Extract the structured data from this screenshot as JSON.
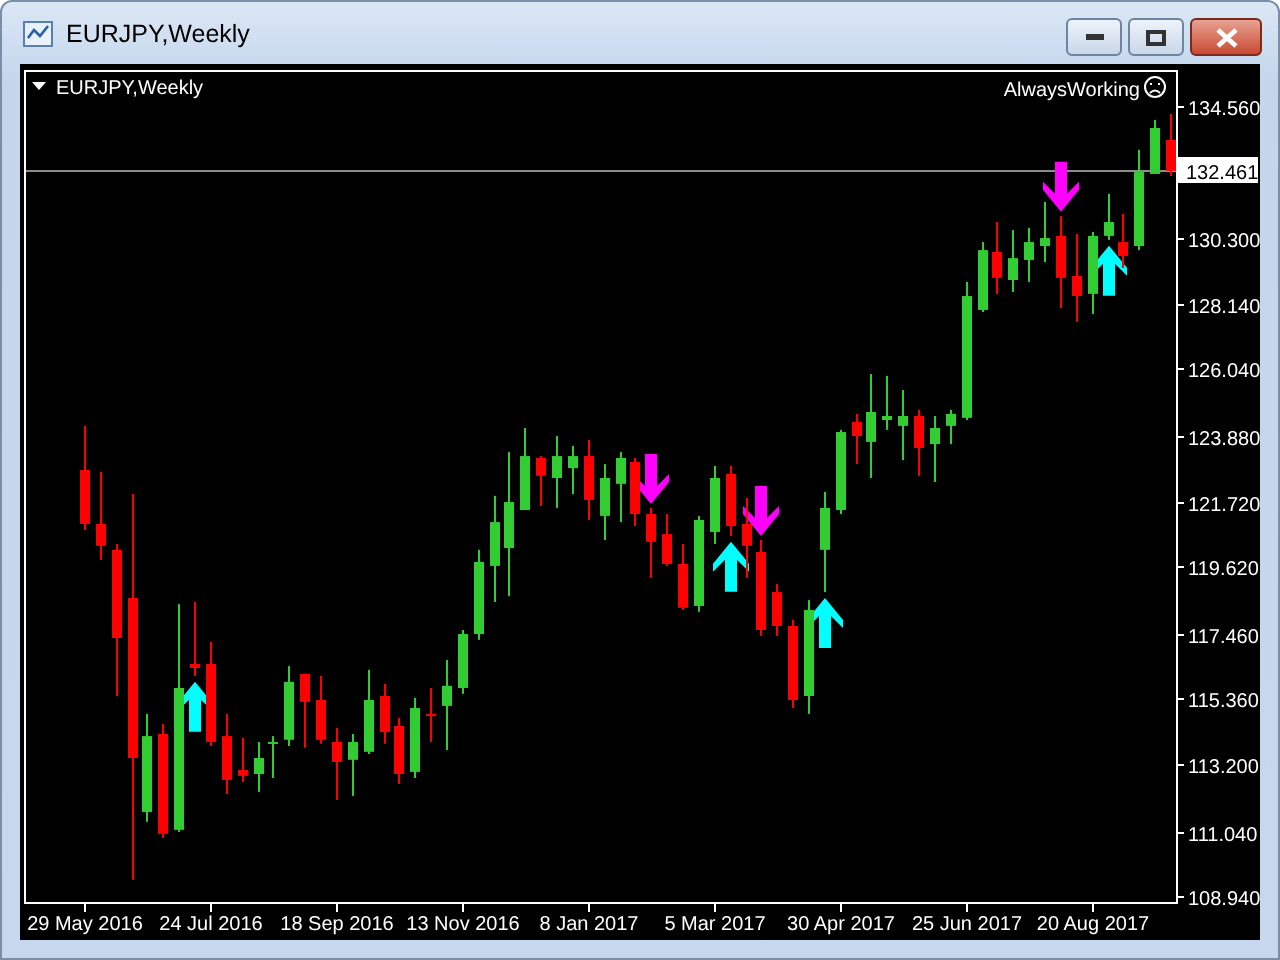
{
  "window": {
    "title": "EURJPY,Weekly"
  },
  "chart": {
    "symbol_label": "EURJPY,Weekly",
    "indicator_label": "AlwaysWorking",
    "chart_data": {
      "type": "candlestick",
      "ylim": [
        108.75,
        135.73
      ],
      "categories": [
        "29 May 2016",
        null,
        null,
        null,
        null,
        null,
        null,
        null,
        "24 Jul 2016",
        null,
        null,
        null,
        null,
        null,
        null,
        null,
        "18 Sep 2016",
        null,
        null,
        null,
        null,
        null,
        null,
        null,
        "13 Nov 2016",
        null,
        null,
        null,
        null,
        null,
        null,
        null,
        "8 Jan 2017",
        null,
        null,
        null,
        null,
        null,
        null,
        null,
        "5 Mar 2017",
        null,
        null,
        null,
        null,
        null,
        null,
        null,
        "30 Apr 2017",
        null,
        null,
        null,
        null,
        null,
        null,
        null,
        "25 Jun 2017",
        null,
        null,
        null,
        null,
        null,
        null,
        null,
        "20 Aug 2017",
        null,
        null,
        null,
        null,
        null
      ],
      "ohlc": [
        [
          122.76,
          124.19,
          120.81,
          121.01
        ],
        [
          121.01,
          122.7,
          119.84,
          120.3
        ],
        [
          120.17,
          120.36,
          115.43,
          117.31
        ],
        [
          118.61,
          121.98,
          109.47,
          113.42
        ],
        [
          111.67,
          114.85,
          111.35,
          114.13
        ],
        [
          114.2,
          114.52,
          110.83,
          110.96
        ],
        [
          111.09,
          118.41,
          111.02,
          115.69
        ],
        [
          116.47,
          118.48,
          116.08,
          116.34
        ],
        [
          116.47,
          117.18,
          113.81,
          113.94
        ],
        [
          114.13,
          114.85,
          112.25,
          112.71
        ],
        [
          113.03,
          114.07,
          112.64,
          112.84
        ],
        [
          112.9,
          113.94,
          112.32,
          113.42
        ],
        [
          113.88,
          114.13,
          112.77,
          113.94
        ],
        [
          114.01,
          116.4,
          113.81,
          115.89
        ],
        [
          116.15,
          116.15,
          113.75,
          115.24
        ],
        [
          115.3,
          116.08,
          113.88,
          114.01
        ],
        [
          113.94,
          114.39,
          112.06,
          113.29
        ],
        [
          113.36,
          114.2,
          112.19,
          113.94
        ],
        [
          113.62,
          116.28,
          113.55,
          115.3
        ],
        [
          115.43,
          115.82,
          113.88,
          114.26
        ],
        [
          114.46,
          114.72,
          112.58,
          112.9
        ],
        [
          112.97,
          115.37,
          112.77,
          115.04
        ],
        [
          114.85,
          115.69,
          113.94,
          114.78
        ],
        [
          115.11,
          116.6,
          113.68,
          115.76
        ],
        [
          115.69,
          117.57,
          115.5,
          117.44
        ],
        [
          117.44,
          120.17,
          117.25,
          119.78
        ],
        [
          119.65,
          121.92,
          118.48,
          121.07
        ],
        [
          120.23,
          123.34,
          118.67,
          121.72
        ],
        [
          121.46,
          124.12,
          121.46,
          123.21
        ],
        [
          123.15,
          123.21,
          121.59,
          122.57
        ],
        [
          122.5,
          123.86,
          121.53,
          123.21
        ],
        [
          122.82,
          123.54,
          121.98,
          123.21
        ],
        [
          123.21,
          123.73,
          121.14,
          121.79
        ],
        [
          121.27,
          122.95,
          120.49,
          122.5
        ],
        [
          122.31,
          123.34,
          121.07,
          123.15
        ],
        [
          123.02,
          123.15,
          120.94,
          121.33
        ],
        [
          121.33,
          121.53,
          119.26,
          120.43
        ],
        [
          120.68,
          121.33,
          119.65,
          119.71
        ],
        [
          119.71,
          120.36,
          118.22,
          118.29
        ],
        [
          118.35,
          121.27,
          118.16,
          121.14
        ],
        [
          120.75,
          122.89,
          120.36,
          122.5
        ],
        [
          122.63,
          122.89,
          120.62,
          120.94
        ],
        [
          121.01,
          121.85,
          119.26,
          120.3
        ],
        [
          120.1,
          120.49,
          117.38,
          117.57
        ],
        [
          118.8,
          119.06,
          117.38,
          117.7
        ],
        [
          117.7,
          117.9,
          115.04,
          115.3
        ],
        [
          115.43,
          118.54,
          114.85,
          118.22
        ],
        [
          120.17,
          122.05,
          118.8,
          121.53
        ],
        [
          121.46,
          124.06,
          121.33,
          123.99
        ],
        [
          124.32,
          124.58,
          122.95,
          123.86
        ],
        [
          123.67,
          125.87,
          122.5,
          124.64
        ],
        [
          124.38,
          125.81,
          124.06,
          124.51
        ],
        [
          124.19,
          125.35,
          123.08,
          124.51
        ],
        [
          124.51,
          124.71,
          122.57,
          123.47
        ],
        [
          123.6,
          124.51,
          122.37,
          124.12
        ],
        [
          124.19,
          124.71,
          123.6,
          124.58
        ],
        [
          124.45,
          128.86,
          124.38,
          128.4
        ],
        [
          127.95,
          130.15,
          127.88,
          129.89
        ],
        [
          129.83,
          130.8,
          128.47,
          128.99
        ],
        [
          128.92,
          130.54,
          128.53,
          129.63
        ],
        [
          129.57,
          130.61,
          128.86,
          130.15
        ],
        [
          130.02,
          131.45,
          129.5,
          130.28
        ],
        [
          130.35,
          131.0,
          128.01,
          128.99
        ],
        [
          129.05,
          130.41,
          127.56,
          128.4
        ],
        [
          128.47,
          130.48,
          127.82,
          130.35
        ],
        [
          130.35,
          131.71,
          130.22,
          130.8
        ],
        [
          130.15,
          131.06,
          129.31,
          129.7
        ],
        [
          130.02,
          133.14,
          129.89,
          132.42
        ],
        [
          132.36,
          134.11,
          132.36,
          133.85
        ],
        [
          133.46,
          134.3,
          132.29,
          132.46
        ]
      ],
      "yticks": [
        {
          "value": 134.56,
          "label": "134.560"
        },
        {
          "value": 130.3,
          "label": "130.300"
        },
        {
          "value": 128.14,
          "label": "128.140"
        },
        {
          "value": 126.04,
          "label": "126.040"
        },
        {
          "value": 123.88,
          "label": "123.880"
        },
        {
          "value": 121.72,
          "label": "121.720"
        },
        {
          "value": 119.62,
          "label": "119.620"
        },
        {
          "value": 117.46,
          "label": "117.460"
        },
        {
          "value": 115.36,
          "label": "115.360"
        },
        {
          "value": 113.2,
          "label": "113.200"
        },
        {
          "value": 111.04,
          "label": "111.040"
        },
        {
          "value": 108.94,
          "label": "108.940"
        }
      ],
      "ref_lines": [
        {
          "axis": "y",
          "value": 132.461,
          "label": "132.461"
        }
      ],
      "series": [
        {
          "type": "scatter",
          "color": "#00ffff",
          "values": [
            null,
            null,
            null,
            null,
            null,
            null,
            null,
            115.08,
            null,
            null,
            null,
            null,
            null,
            null,
            null,
            null,
            null,
            null,
            null,
            null,
            null,
            null,
            null,
            null,
            null,
            null,
            null,
            null,
            null,
            null,
            null,
            null,
            null,
            null,
            null,
            null,
            null,
            null,
            null,
            null,
            null,
            119.62,
            null,
            null,
            null,
            null,
            null,
            117.8,
            null,
            null,
            null,
            null,
            null,
            null,
            null,
            null,
            null,
            null,
            null,
            null,
            null,
            null,
            null,
            null,
            null,
            129.22,
            null,
            null,
            null,
            null
          ]
        },
        {
          "type": "scatter",
          "color": "#ff00ff",
          "values": [
            null,
            null,
            null,
            null,
            null,
            null,
            null,
            null,
            null,
            null,
            null,
            null,
            null,
            null,
            null,
            null,
            null,
            null,
            null,
            null,
            null,
            null,
            null,
            null,
            null,
            null,
            null,
            null,
            null,
            null,
            null,
            null,
            null,
            null,
            null,
            null,
            122.47,
            null,
            null,
            null,
            null,
            null,
            null,
            121.43,
            null,
            null,
            null,
            null,
            null,
            null,
            null,
            null,
            null,
            null,
            null,
            null,
            null,
            null,
            null,
            null,
            null,
            null,
            131.94,
            null,
            null,
            null,
            null,
            null,
            null,
            null
          ]
        }
      ]
    }
  }
}
